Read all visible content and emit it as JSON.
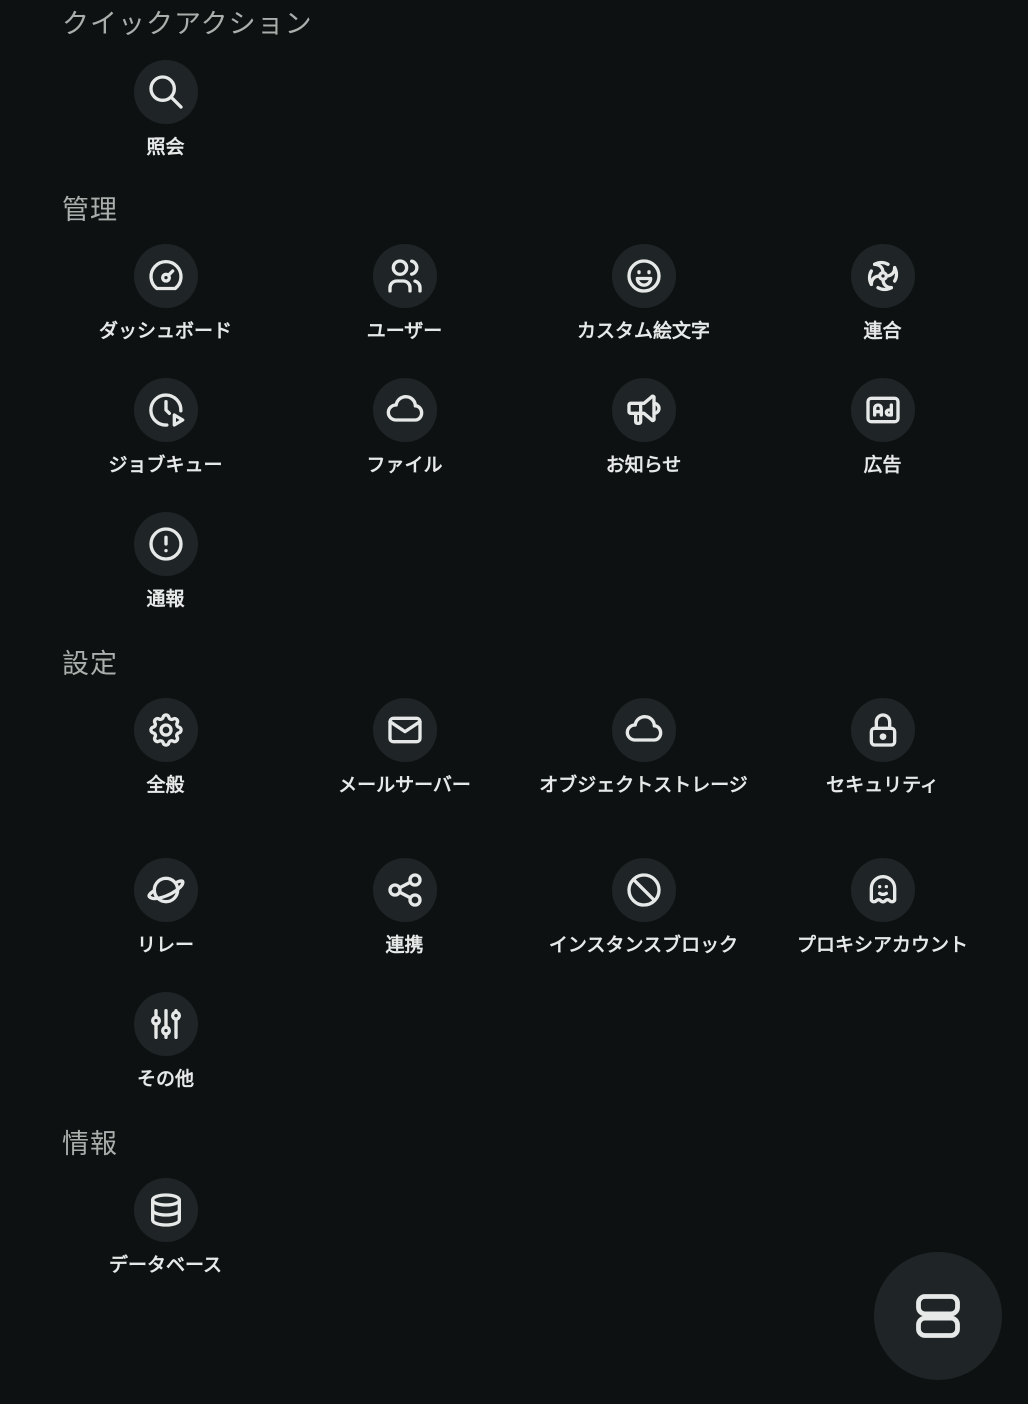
{
  "sections": [
    {
      "title": "クイックアクション",
      "items": [
        {
          "label": "照会",
          "icon": "search-icon"
        }
      ]
    },
    {
      "title": "管理",
      "items": [
        {
          "label": "ダッシュボード",
          "icon": "dashboard-gauge-icon"
        },
        {
          "label": "ユーザー",
          "icon": "users-icon"
        },
        {
          "label": "カスタム絵文字",
          "icon": "smile-icon"
        },
        {
          "label": "連合",
          "icon": "federation-swirl-icon"
        },
        {
          "label": "ジョブキュー",
          "icon": "clock-play-icon"
        },
        {
          "label": "ファイル",
          "icon": "cloud-icon"
        },
        {
          "label": "お知らせ",
          "icon": "speakerphone-icon"
        },
        {
          "label": "広告",
          "icon": "ad-icon"
        },
        {
          "label": "通報",
          "icon": "exclamation-circle-icon"
        }
      ]
    },
    {
      "title": "設定",
      "items": [
        {
          "label": "全般",
          "icon": "gear-icon"
        },
        {
          "label": "メールサーバー",
          "icon": "mail-icon"
        },
        {
          "label": "オブジェクトストレージ",
          "icon": "cloud-icon"
        },
        {
          "label": "セキュリティ",
          "icon": "lock-icon"
        },
        {
          "label": "リレー",
          "icon": "planet-icon"
        },
        {
          "label": "連携",
          "icon": "share-icon"
        },
        {
          "label": "インスタンスブロック",
          "icon": "ban-icon"
        },
        {
          "label": "プロキシアカウント",
          "icon": "ghost-icon"
        },
        {
          "label": "その他",
          "icon": "sliders-icon"
        }
      ]
    },
    {
      "title": "情報",
      "items": [
        {
          "label": "データベース",
          "icon": "database-icon"
        }
      ]
    }
  ],
  "fab": {
    "icon": "server-icon"
  },
  "colors": {
    "background": "#0d1112",
    "circle": "#1f2527",
    "text": "#e6e9e7",
    "section_title": "#a9afab"
  }
}
